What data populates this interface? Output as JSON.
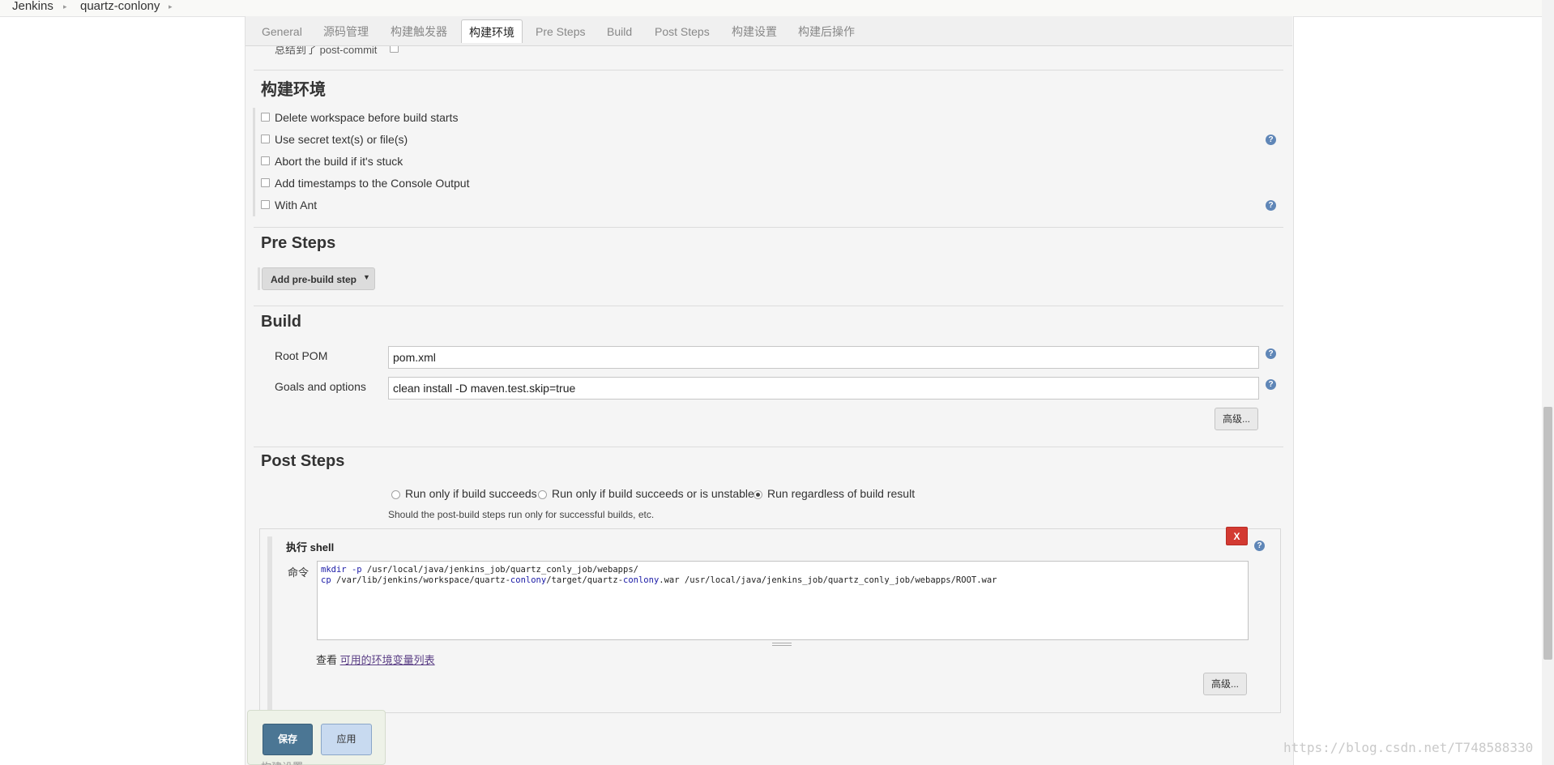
{
  "breadcrumb": {
    "items": [
      "Jenkins",
      "quartz-conlony"
    ]
  },
  "tabs": [
    {
      "label": "General",
      "active": false
    },
    {
      "label": "源码管理",
      "active": false
    },
    {
      "label": "构建触发器",
      "active": false
    },
    {
      "label": "构建环境",
      "active": true
    },
    {
      "label": "Pre Steps",
      "active": false
    },
    {
      "label": "Build",
      "active": false
    },
    {
      "label": "Post Steps",
      "active": false
    },
    {
      "label": "构建设置",
      "active": false
    },
    {
      "label": "构建后操作",
      "active": false
    }
  ],
  "cut_row": {
    "label": "总结到了 post-commit"
  },
  "build_env": {
    "title": "构建环境",
    "options": [
      {
        "label": "Delete workspace before build starts",
        "checked": false
      },
      {
        "label": "Use secret text(s) or file(s)",
        "checked": false
      },
      {
        "label": "Abort the build if it's stuck",
        "checked": false
      },
      {
        "label": "Add timestamps to the Console Output",
        "checked": false
      },
      {
        "label": "With Ant",
        "checked": false
      }
    ]
  },
  "pre_steps": {
    "title": "Pre Steps",
    "add_button": "Add pre-build step"
  },
  "build": {
    "title": "Build",
    "root_pom_label": "Root POM",
    "root_pom_value": "pom.xml",
    "goals_label": "Goals and options",
    "goals_value": "clean install -D maven.test.skip=true",
    "advanced_button": "高级..."
  },
  "post_steps": {
    "title": "Post Steps",
    "radio_options": [
      {
        "label": "Run only if build succeeds",
        "checked": false
      },
      {
        "label": "Run only if build succeeds or is unstable",
        "checked": false
      },
      {
        "label": "Run regardless of build result",
        "checked": true
      }
    ],
    "radio_hint": "Should the post-build steps run only for successful builds, etc.",
    "shell": {
      "title": "执行 shell",
      "delete_label": "X",
      "command_label": "命令",
      "command_line1_cmd": "mkdir",
      "command_line1_flag": "-p",
      "command_line1_rest": " /usr/local/java/jenkins_job/quartz_conly_job/webapps/",
      "command_line2_cmd": "cp",
      "command_line2_a": " /var/lib/jenkins/workspace/quartz-",
      "command_line2_kw": "conlony",
      "command_line2_b": "/target/quartz-",
      "command_line2_kw2": "conlony",
      "command_line2_c": ".war /usr/local/java/jenkins_job/quartz_conly_job/webapps/ROOT.war",
      "env_prefix": "查看 ",
      "env_link": "可用的环境变量列表",
      "advanced_button": "高级..."
    }
  },
  "footer": {
    "save": "保存",
    "apply": "应用",
    "cut_text": "构建设置"
  },
  "help_glyph": "?",
  "watermark": "https://blog.csdn.net/T748588330",
  "colors": {
    "save_button": "#4b7694",
    "apply_button": "#c8daf0",
    "delete_button": "#d33a32",
    "help_icon": "#5f86b7",
    "link": "#5a3e85"
  }
}
